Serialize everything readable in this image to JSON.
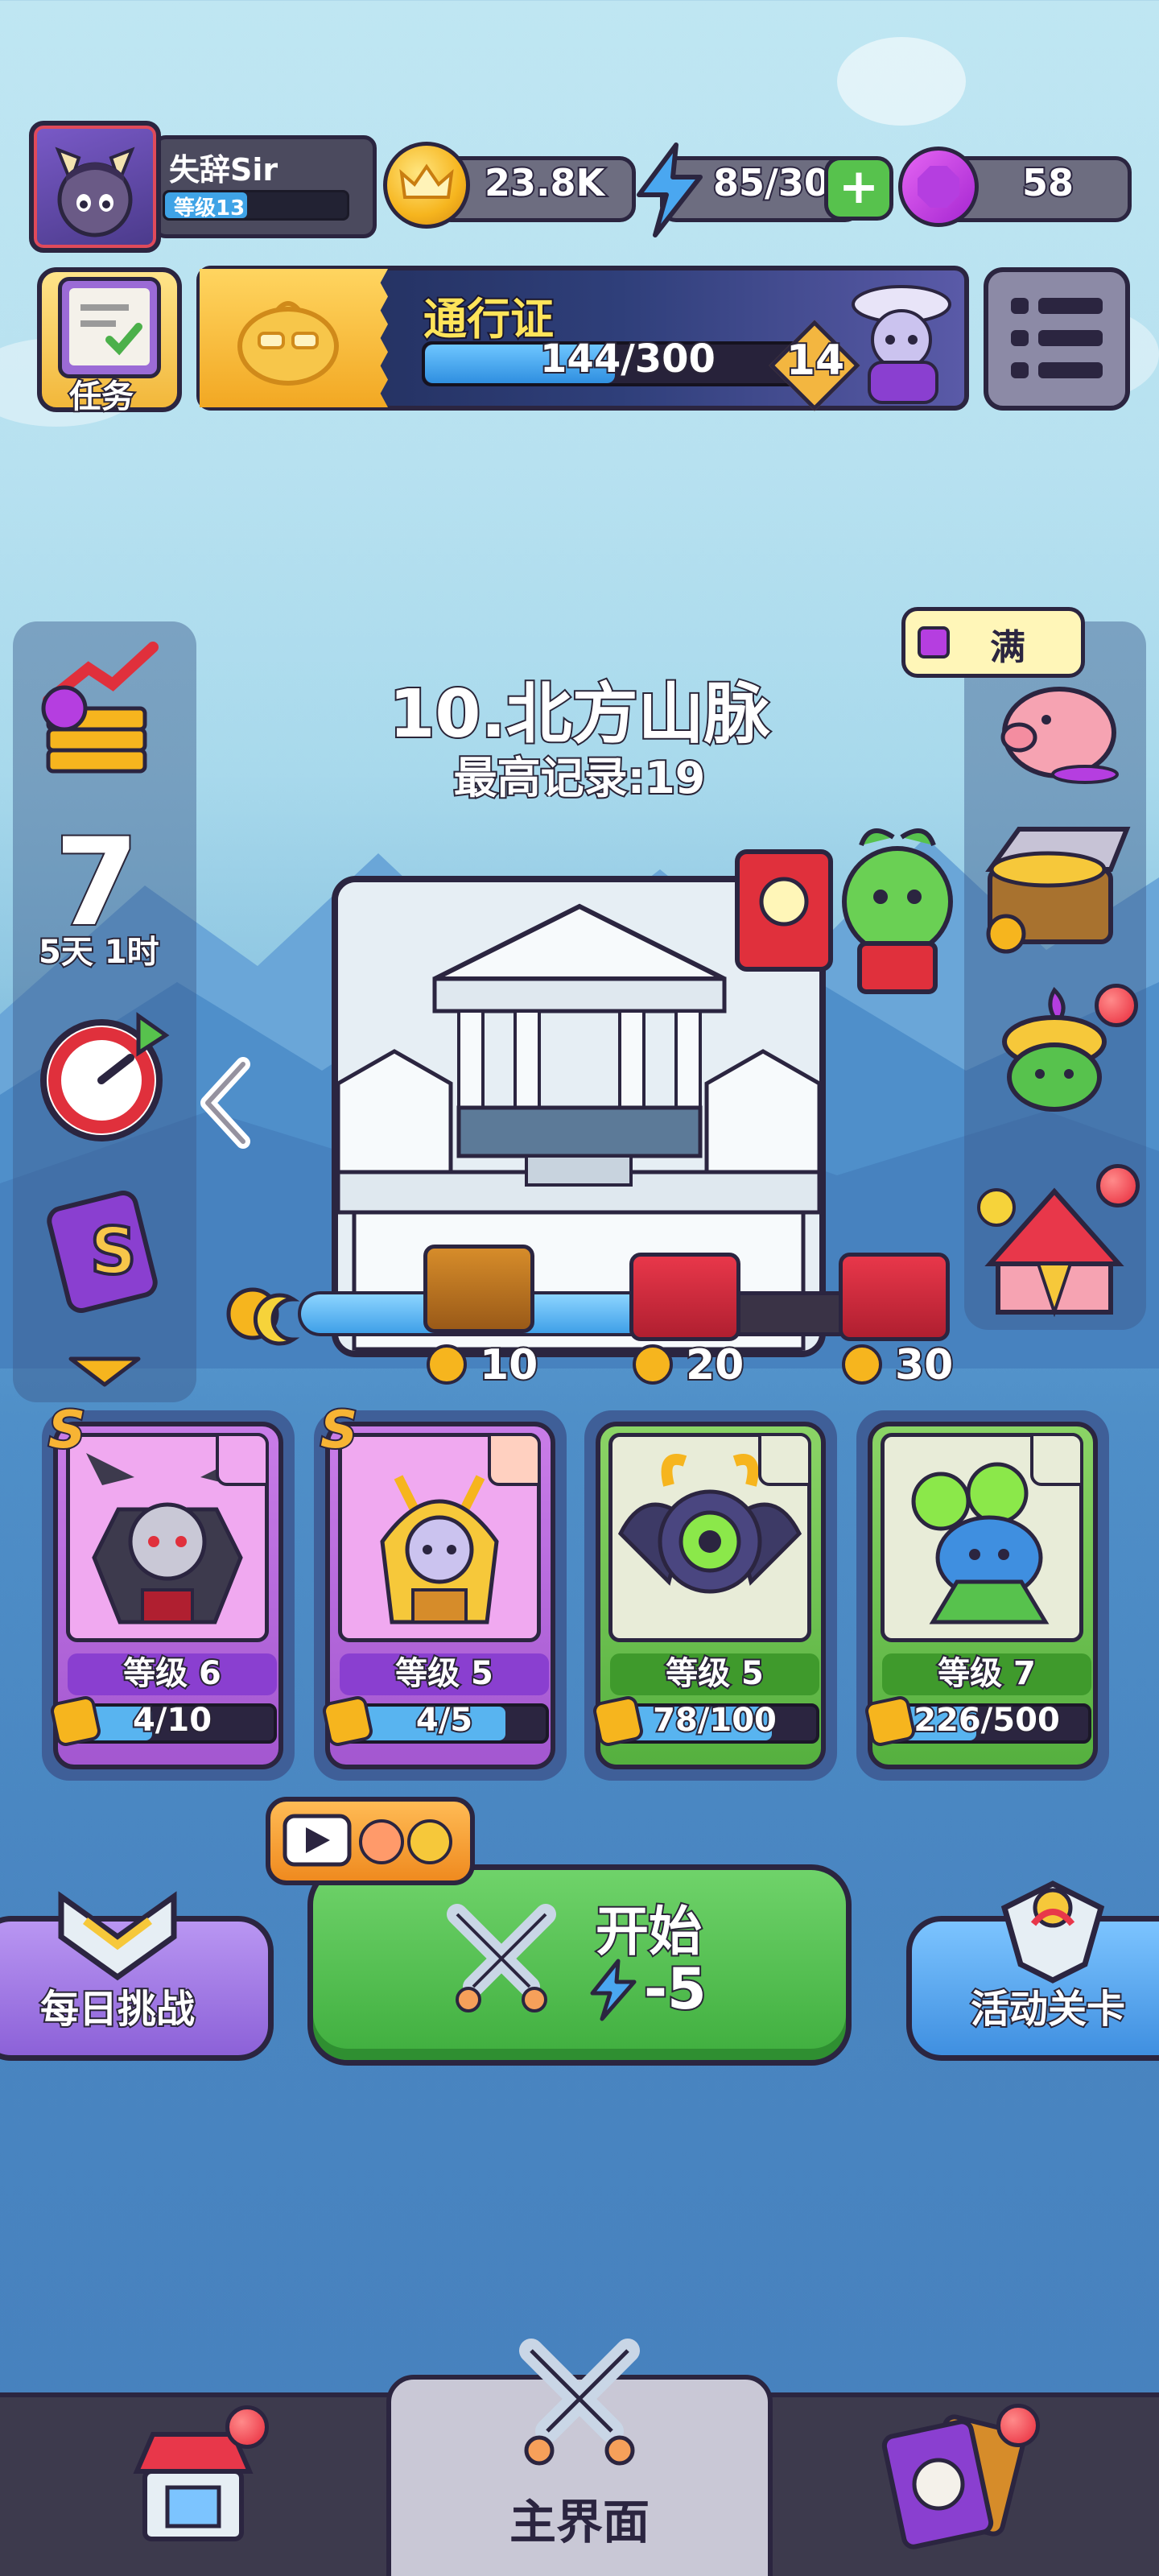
{
  "player": {
    "name": "失辞Sir",
    "level_label": "等级13",
    "level_progress": 0.45
  },
  "resources": {
    "coins": "23.8K",
    "energy": "85/30",
    "gems": "58"
  },
  "top_row": {
    "task_label": "任务",
    "pass_title": "通行证",
    "pass_progress_text": "144/300",
    "pass_progress": 0.48,
    "pass_level": "14"
  },
  "stage": {
    "title": "10.北方山脉",
    "record": "最高记录:19",
    "progress": 0.64,
    "rewards": [
      {
        "label": "10"
      },
      {
        "label": "20"
      },
      {
        "label": "30"
      }
    ]
  },
  "left_sidebar": {
    "timer_label": "5天 1时",
    "calendar_number": "7"
  },
  "right_sidebar": {
    "full_label": "满"
  },
  "heroes": [
    {
      "rarity": "S",
      "level": "等级 6",
      "shards": "4/10",
      "shard_progress": 0.4,
      "theme": "purple",
      "element": "bat"
    },
    {
      "rarity": "S",
      "level": "等级 5",
      "shards": "4/5",
      "shard_progress": 0.8,
      "theme": "purple",
      "element": "fire"
    },
    {
      "rarity": "",
      "level": "等级 5",
      "shards": "78/100",
      "shard_progress": 0.78,
      "theme": "green",
      "element": "fire"
    },
    {
      "rarity": "",
      "level": "等级 7",
      "shards": "226/500",
      "shard_progress": 0.45,
      "theme": "green",
      "element": "water"
    }
  ],
  "actions": {
    "start_label": "开始",
    "start_cost": "-5",
    "daily_label": "每日挑战",
    "event_label": "活动关卡"
  },
  "nav": {
    "main_label": "主界面"
  },
  "colors": {
    "outline": "#2b2540",
    "accent_green": "#57c24d",
    "accent_purple": "#a357d0",
    "bar_blue": "#3fa0e8"
  }
}
